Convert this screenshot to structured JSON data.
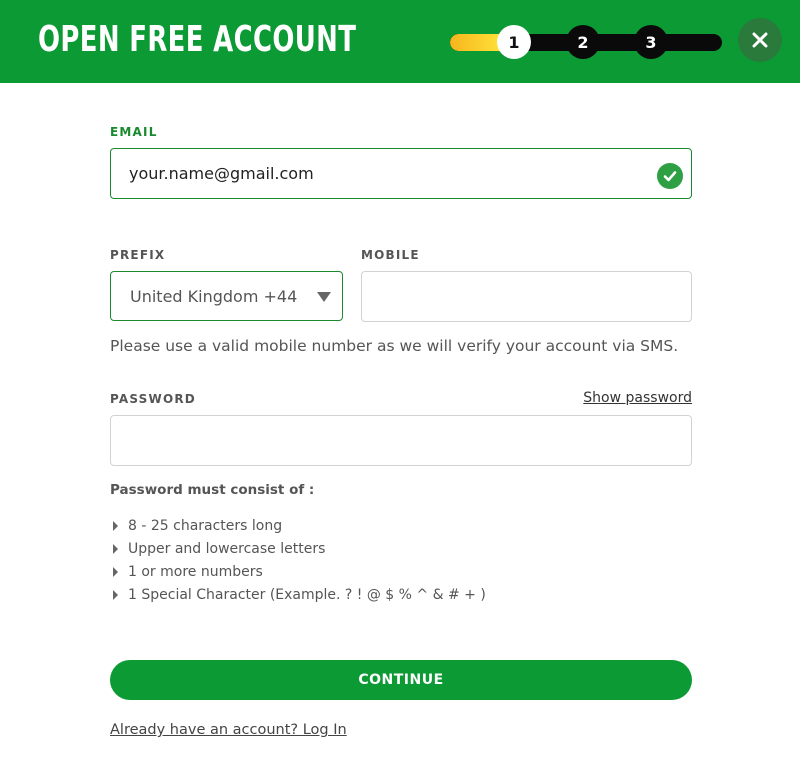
{
  "header": {
    "title": "OPEN FREE ACCOUNT",
    "steps": [
      "1",
      "2",
      "3"
    ],
    "current_step": 1,
    "progress_fraction": 0.19,
    "close_icon": "close-icon"
  },
  "form": {
    "email": {
      "label": "EMAIL",
      "value": "your.name@gmail.com",
      "status_icon": "check-circle-icon"
    },
    "prefix": {
      "label": "PREFIX",
      "selected": "United Kingdom +44"
    },
    "mobile": {
      "label": "MOBILE",
      "value": ""
    },
    "mobile_hint": "Please use a valid mobile number as we will verify your account via SMS.",
    "password": {
      "label": "PASSWORD",
      "value": "",
      "show_link": "Show password"
    },
    "rules_title": "Password must consist of :",
    "rules": [
      "8 - 25 characters long",
      "Upper and lowercase letters",
      "1 or more numbers",
      "1 Special Character (Example. ? ! @ $ % ^ & # + )"
    ],
    "continue_label": "CONTINUE",
    "login_link": "Already have an account? Log In"
  },
  "colors": {
    "brand_green": "#0c9a35",
    "progress_yellow": "#f6b51c",
    "valid_green": "#2ea043"
  }
}
